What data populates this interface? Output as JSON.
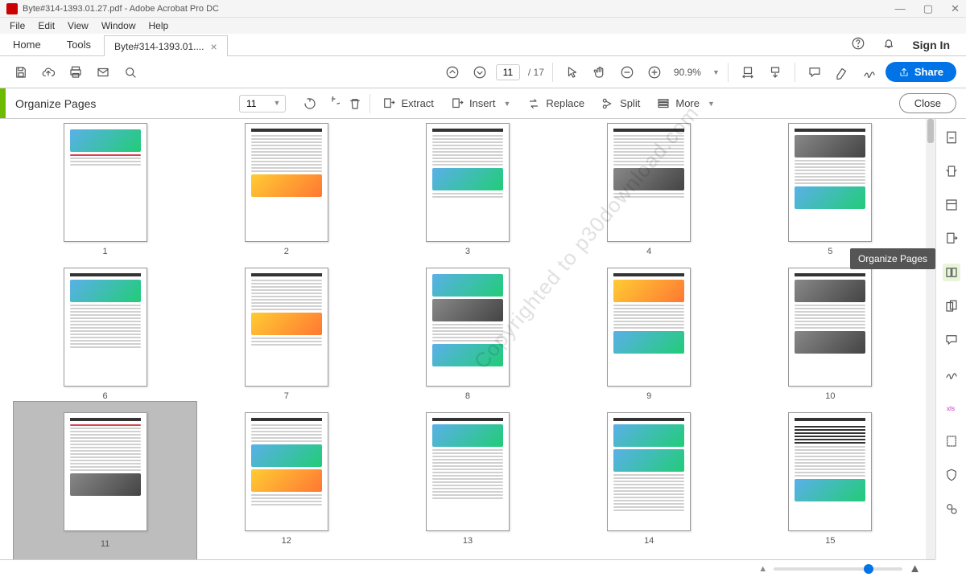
{
  "window": {
    "title": "Byte#314-1393.01.27.pdf - Adobe Acrobat Pro DC"
  },
  "menu": {
    "file": "File",
    "edit": "Edit",
    "view": "View",
    "window": "Window",
    "help": "Help"
  },
  "tabs": {
    "home": "Home",
    "tools": "Tools",
    "doc": "Byte#314-1393.01....",
    "close": "×",
    "signin": "Sign In"
  },
  "toolbar": {
    "page_current": "11",
    "page_total": "/  17",
    "zoom": "90.9%",
    "share": "Share"
  },
  "organize": {
    "title": "Organize Pages",
    "page_select": "11",
    "extract": "Extract",
    "insert": "Insert",
    "replace": "Replace",
    "split": "Split",
    "more": "More",
    "close": "Close"
  },
  "thumbs": {
    "total": 15,
    "selected": 11,
    "labels": [
      "1",
      "2",
      "3",
      "4",
      "5",
      "6",
      "7",
      "8",
      "9",
      "10",
      "11",
      "12",
      "13",
      "14",
      "15"
    ]
  },
  "tooltip": {
    "organize_pages": "Organize Pages"
  }
}
